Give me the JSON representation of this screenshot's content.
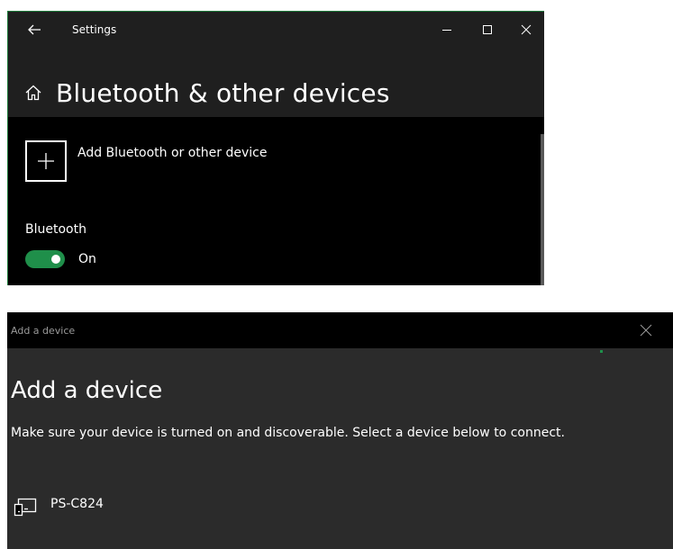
{
  "settings_window": {
    "title": "Settings",
    "heading": "Bluetooth & other devices",
    "add_device_label": "Add Bluetooth or other device",
    "bluetooth_label": "Bluetooth",
    "bluetooth_toggle_state": "On",
    "toggle_on": true,
    "accent_color": "#1f8f4a"
  },
  "add_device_dialog": {
    "window_title": "Add a device",
    "heading": "Add a device",
    "description": "Make sure your device is turned on and discoverable. Select a device below to connect.",
    "devices": [
      {
        "name": "PS-C824",
        "icon": "device-icon"
      }
    ]
  }
}
